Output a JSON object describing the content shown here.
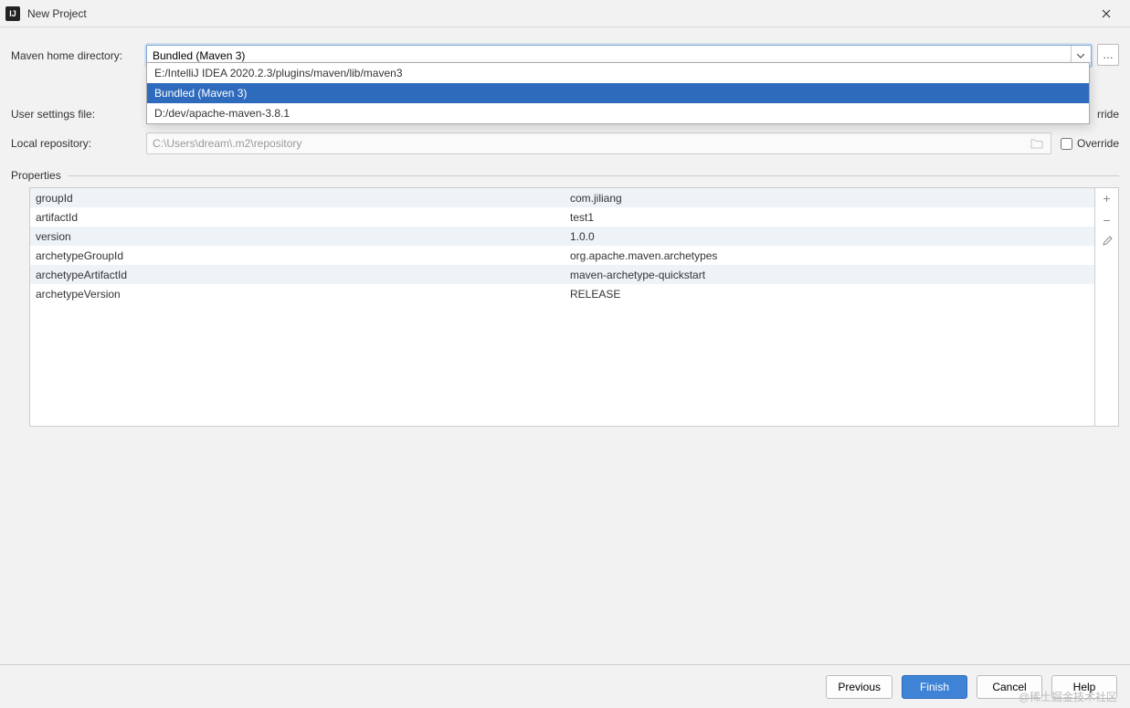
{
  "title": "New Project",
  "labels": {
    "maven_home": "Maven home directory:",
    "user_settings": "User settings file:",
    "local_repo": "Local repository:",
    "properties": "Properties",
    "override": "Override"
  },
  "maven_home_value": "Bundled (Maven 3)",
  "dropdown": [
    "E:/IntelliJ IDEA 2020.2.3/plugins/maven/lib/maven3",
    "Bundled (Maven 3)",
    "D:/dev/apache-maven-3.8.1"
  ],
  "user_settings_value": "",
  "local_repo_value": "C:\\Users\\dream\\.m2\\repository",
  "properties_rows": [
    {
      "k": "groupId",
      "v": "com.jiliang"
    },
    {
      "k": "artifactId",
      "v": "test1"
    },
    {
      "k": "version",
      "v": "1.0.0"
    },
    {
      "k": "archetypeGroupId",
      "v": "org.apache.maven.archetypes"
    },
    {
      "k": "archetypeArtifactId",
      "v": "maven-archetype-quickstart"
    },
    {
      "k": "archetypeVersion",
      "v": "RELEASE"
    }
  ],
  "buttons": {
    "previous": "Previous",
    "finish": "Finish",
    "cancel": "Cancel",
    "help": "Help"
  },
  "overflow_text": "rride",
  "watermark": "@稀土掘金技术社区"
}
